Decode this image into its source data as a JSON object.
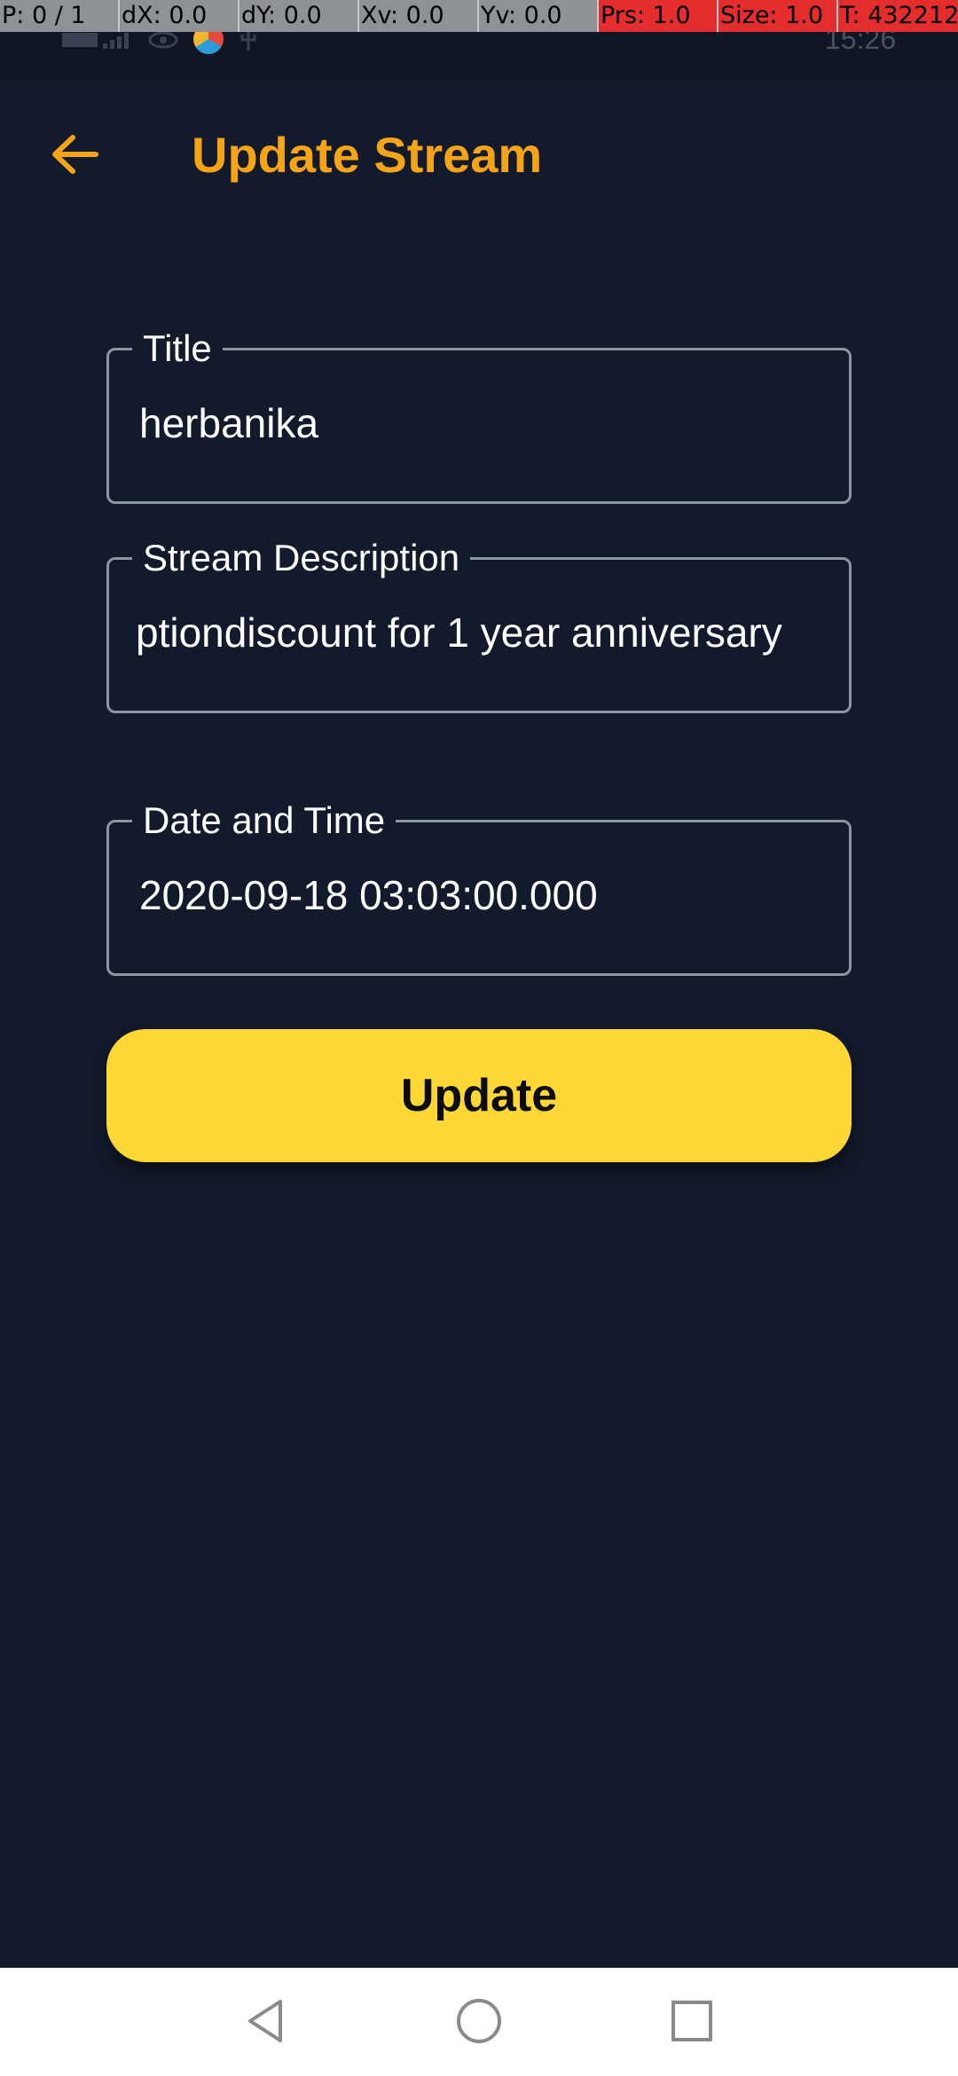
{
  "debug_overlay": {
    "cells": [
      "P: 0 / 1",
      "dX: 0.0",
      "dY: 0.0",
      "Xv: 0.0",
      "Yv: 0.0",
      "Prs: 1.0",
      "Size: 1.0",
      "T: 432212"
    ]
  },
  "status_bar": {
    "time": "15:26"
  },
  "header": {
    "title": "Update Stream",
    "back_icon": "arrow-left-icon"
  },
  "form": {
    "title_field": {
      "label": "Title",
      "value": "herbanika"
    },
    "description_field": {
      "label": "Stream Description",
      "value": "ptiondiscount for 1 year anniversary"
    },
    "datetime_field": {
      "label": "Date  and Time",
      "value": "2020-09-18 03:03:00.000"
    },
    "submit_label": "Update"
  },
  "nav_bar": {
    "back_icon": "triangle-back-icon",
    "home_icon": "circle-home-icon",
    "recents_icon": "square-recents-icon"
  },
  "colors": {
    "background": "#121a2b",
    "accent": "#f5a416",
    "button": "#fdd835",
    "field_border": "#8d96a3"
  }
}
